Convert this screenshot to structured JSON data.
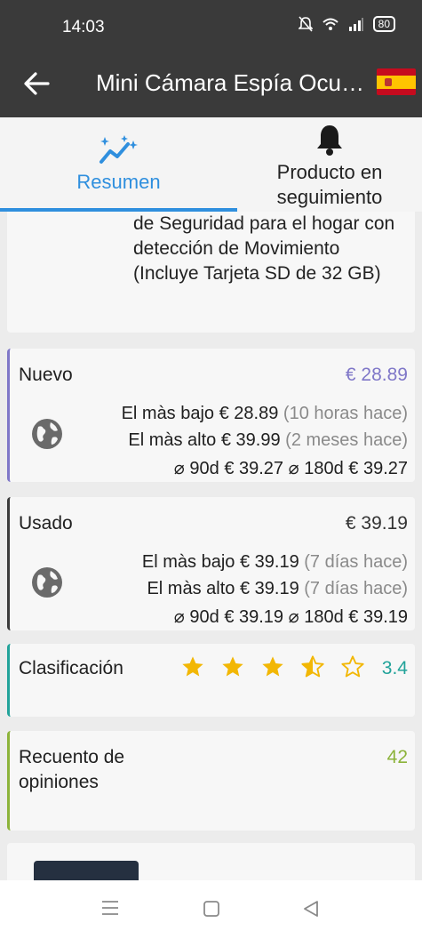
{
  "status_bar": {
    "time": "14:03",
    "battery": "80"
  },
  "app_bar": {
    "title": "Mini Cámara Espía Ocu…"
  },
  "tabs": [
    {
      "label": "Resumen"
    },
    {
      "label": "Producto en seguimiento"
    }
  ],
  "description": "lá batería Cámara de vigilancia de Seguridad para el hogar con detección de Movimiento (Incluye Tarjeta SD de 32 GB)",
  "prices": {
    "nuevo": {
      "name": "Nuevo",
      "current": "€ 28.89",
      "lowest_label": "El màs bajo",
      "lowest_value": "€ 28.89",
      "lowest_when": "(10 horas hace)",
      "highest_label": "El màs alto",
      "highest_value": "€ 39.99",
      "highest_when": "(2 meses hace)",
      "avg90_label": "⌀ 90d",
      "avg90_value": "€ 39.27",
      "avg180_label": "⌀ 180d",
      "avg180_value": "€ 39.27"
    },
    "usado": {
      "name": "Usado",
      "current": "€ 39.19",
      "lowest_label": "El màs bajo",
      "lowest_value": "€ 39.19",
      "lowest_when": "(7 días hace)",
      "highest_label": "El màs alto",
      "highest_value": "€ 39.19",
      "highest_when": "(7 días hace)",
      "avg90_label": "⌀ 90d",
      "avg90_value": "€ 39.19",
      "avg180_label": "⌀ 180d",
      "avg180_value": "€ 39.19"
    }
  },
  "rating": {
    "label": "Clasificación",
    "value": "3.4",
    "stars_filled": 3,
    "stars_half": 1,
    "stars_total": 5
  },
  "reviews": {
    "label": "Recuento de opiniones",
    "value": "42"
  },
  "colors": {
    "accent": "#2f8fde",
    "nuevo": "#7f77c8",
    "rating": "#22a39a",
    "reviews": "#8cb33a",
    "star": "#f2b705"
  },
  "icons": [
    "back-arrow-icon",
    "spain-flag-icon",
    "trend-sparkle-icon",
    "bell-icon",
    "globe-icon",
    "star-icon",
    "menu-icon",
    "home-icon",
    "back-triangle-icon"
  ]
}
